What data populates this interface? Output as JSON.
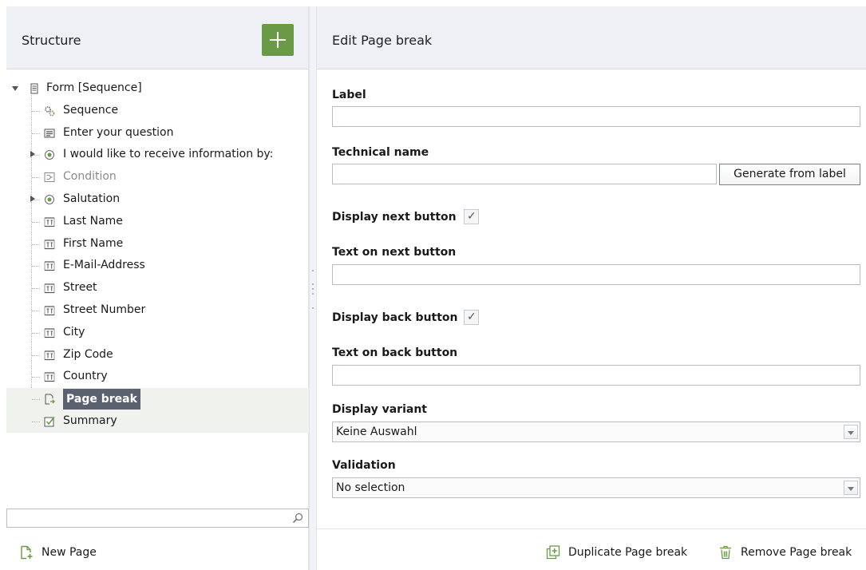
{
  "structure": {
    "title": "Structure",
    "add_icon": "plus-icon",
    "tree": [
      {
        "label": "Form [Sequence]",
        "icon": "form-icon",
        "level": 0,
        "twisty": "down"
      },
      {
        "label": "Sequence",
        "icon": "gears-icon",
        "level": 1
      },
      {
        "label": "Enter your question",
        "icon": "text-block-icon",
        "level": 1
      },
      {
        "label": "I would like to receive information by:",
        "icon": "radio-icon",
        "level": 1,
        "twisty": "right"
      },
      {
        "label": "Condition",
        "icon": "condition-icon",
        "level": 1,
        "dim": true
      },
      {
        "label": "Salutation",
        "icon": "radio-icon",
        "level": 1,
        "twisty": "right"
      },
      {
        "label": "Last Name",
        "icon": "text-field-icon",
        "level": 1
      },
      {
        "label": "First Name",
        "icon": "text-field-icon",
        "level": 1
      },
      {
        "label": "E-Mail-Address",
        "icon": "text-field-icon",
        "level": 1
      },
      {
        "label": "Street",
        "icon": "text-field-icon",
        "level": 1
      },
      {
        "label": "Street Number",
        "icon": "text-field-icon",
        "level": 1
      },
      {
        "label": "City",
        "icon": "text-field-icon",
        "level": 1
      },
      {
        "label": "Zip Code",
        "icon": "text-field-icon",
        "level": 1
      },
      {
        "label": "Country",
        "icon": "text-field-icon",
        "level": 1
      },
      {
        "label": "Page break",
        "icon": "page-break-icon",
        "level": 1,
        "selected": true
      },
      {
        "label": "Summary",
        "icon": "summary-icon",
        "level": 1
      }
    ],
    "search_placeholder": "",
    "search_icon": "search-icon",
    "new_page_label": "New Page",
    "new_page_icon": "new-page-icon"
  },
  "editor": {
    "title": "Edit Page break",
    "label_field": {
      "label": "Label",
      "value": ""
    },
    "technical_name": {
      "label": "Technical name",
      "value": "",
      "generate_button": "Generate from label"
    },
    "display_next": {
      "label": "Display next button",
      "checked": true
    },
    "next_text": {
      "label": "Text on next button",
      "value": ""
    },
    "display_back": {
      "label": "Display back button",
      "checked": true
    },
    "back_text": {
      "label": "Text on back button",
      "value": ""
    },
    "display_variant": {
      "label": "Display variant",
      "selected": "Keine Auswahl"
    },
    "validation": {
      "label": "Validation",
      "selected": "No selection"
    },
    "duplicate_label": "Duplicate Page break",
    "duplicate_icon": "duplicate-icon",
    "remove_label": "Remove Page break",
    "remove_icon": "trash-icon"
  },
  "colors": {
    "accent_green": "#6b9a47",
    "header_bg": "#eef0f6",
    "selection_bg": "#5a6270"
  }
}
